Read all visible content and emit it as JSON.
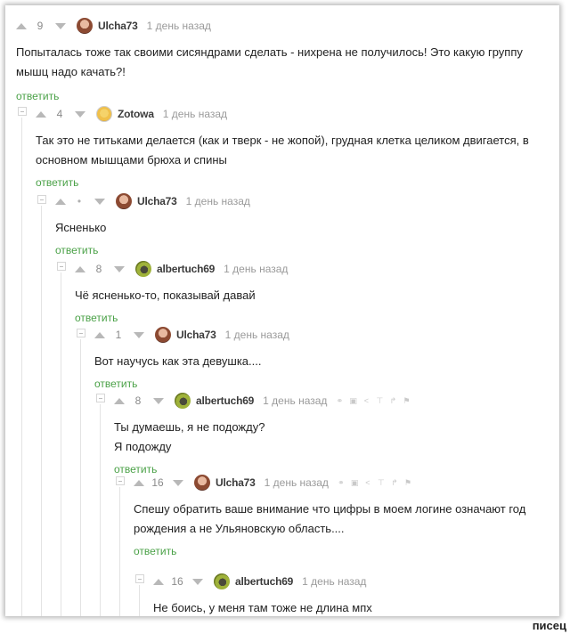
{
  "comments": [
    {
      "rating": "9",
      "author": "Ulcha73",
      "time": "1 день назад",
      "lines": [
        "Попыталась тоже так своими сисяндрами сделать - нихрена не получилось! Это какую группу",
        "мышц надо качать?!"
      ],
      "reply": "ответить",
      "avatar": "ulcha-avatar"
    },
    {
      "rating": "4",
      "author": "Zotowa",
      "time": "1 день назад",
      "lines": [
        "Так это не титьками делается (как и тверк - не жопой), грудная клетка целиком двигается, в",
        "основном мышцами брюха и спины"
      ],
      "reply": "ответить",
      "avatar": "zotowa-avatar"
    },
    {
      "rating": "•",
      "author": "Ulcha73",
      "time": "1 день назад",
      "lines": [
        "Ясненько"
      ],
      "reply": "ответить",
      "avatar": "ulcha-avatar"
    },
    {
      "rating": "8",
      "author": "albertuch69",
      "time": "1 день назад",
      "lines": [
        "Чё ясненько-то, показывай давай"
      ],
      "reply": "ответить",
      "avatar": "albertuch-avatar"
    },
    {
      "rating": "1",
      "author": "Ulcha73",
      "time": "1 день назад",
      "lines": [
        "Вот научусь как эта девушка...."
      ],
      "reply": "ответить",
      "avatar": "ulcha-avatar"
    },
    {
      "rating": "8",
      "author": "albertuch69",
      "time": "1 день назад",
      "lines": [
        "Ты думаешь, я не подожду?",
        "Я подожду"
      ],
      "reply": "ответить",
      "avatar": "albertuch-avatar"
    },
    {
      "rating": "16",
      "author": "Ulcha73",
      "time": "1 день назад",
      "lines": [
        "Спешу обратить ваше внимание что цифры в моем логине означают год",
        "рождения а не Ульяновскую область...."
      ],
      "reply": "ответить",
      "avatar": "ulcha-avatar"
    },
    {
      "rating": "16",
      "author": "albertuch69",
      "time": "1 день назад",
      "lines": [
        "Не боись, у меня там тоже не длина мпх"
      ],
      "avatar": "albertuch-avatar"
    }
  ],
  "tool_icons": [
    "link-icon",
    "save-icon",
    "share-icon",
    "pin-icon",
    "branch-icon",
    "flag-icon"
  ],
  "watermark": "писец",
  "colors": {
    "reply_link": "#4aa147",
    "vote_arrow": "#b8b8b8",
    "thread_line": "#e3e3e3"
  }
}
